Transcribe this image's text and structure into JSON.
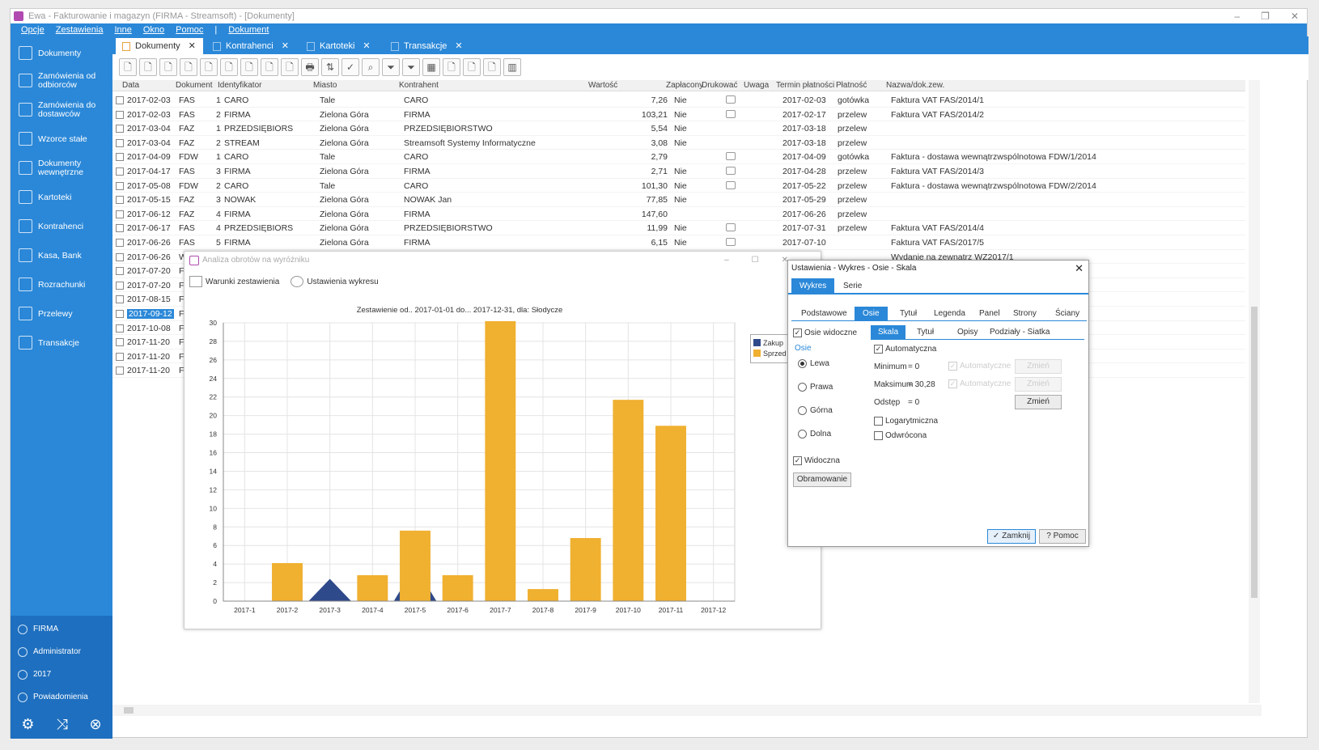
{
  "window": {
    "title": "Ewa - Fakturowanie i magazyn (FIRMA - Streamsoft) - [Dokumenty]",
    "controls": [
      "–",
      "❐",
      "✕"
    ]
  },
  "menu": [
    "Opcje",
    "Zestawienia",
    "Inne",
    "Okno",
    "Pomoc",
    "|",
    "Dokument"
  ],
  "sidebar": {
    "items": [
      {
        "label": "Dokumenty",
        "icon": "documents-icon"
      },
      {
        "label": "Zamówienia od odbiorców",
        "icon": "orders-in-icon"
      },
      {
        "label": "Zamówienia do dostawców",
        "icon": "orders-out-icon"
      },
      {
        "label": "Wzorce stałe",
        "icon": "templates-icon"
      },
      {
        "label": "Dokumenty wewnętrzne",
        "icon": "internal-docs-icon"
      },
      {
        "label": "Kartoteki",
        "icon": "cards-icon"
      },
      {
        "label": "Kontrahenci",
        "icon": "contractors-icon"
      },
      {
        "label": "Kasa, Bank",
        "icon": "cash-bank-icon"
      },
      {
        "label": "Rozrachunki",
        "icon": "settlements-icon"
      },
      {
        "label": "Przelewy",
        "icon": "transfers-icon"
      },
      {
        "label": "Transakcje",
        "icon": "transactions-icon"
      }
    ],
    "bottom": [
      {
        "label": "FIRMA",
        "icon": "home-icon"
      },
      {
        "label": "Administrator",
        "icon": "user-icon"
      },
      {
        "label": "2017",
        "icon": "calendar-icon"
      },
      {
        "label": "Powiadomienia",
        "icon": "bell-icon"
      }
    ],
    "tools": [
      "⚙",
      "⤨",
      "⊗"
    ]
  },
  "tabs": [
    {
      "label": "Dokumenty",
      "close": "✕"
    },
    {
      "label": "Kontrahenci",
      "close": "✕"
    },
    {
      "label": "Kartoteki",
      "close": "✕"
    },
    {
      "label": "Transakcje",
      "close": "✕"
    }
  ],
  "toolbar_icons": [
    "🗋",
    "🗋",
    "🗋",
    "🗋",
    "🗋",
    "🗋",
    "🗋",
    "🗋",
    "🗋",
    "🖶",
    "⇅",
    "✓",
    "⌕",
    "⏷",
    "⏷",
    "▦",
    "🗋",
    "🗋",
    "🗋",
    "▥"
  ],
  "grid": {
    "headers": [
      "Data",
      "Dokument",
      "Identyfikator",
      "Miasto",
      "Kontrahent",
      "Wartość",
      "Zapłacony",
      "Drukować",
      "Uwaga",
      "Termin płatności",
      "Płatność",
      "Nazwa/dok.zew."
    ],
    "rows": [
      {
        "date": "2017-02-03",
        "doc": "FAS",
        "num": "1",
        "id": "CARO",
        "city": "Tale",
        "contractor": "CARO",
        "value": "7,26",
        "paid": "Nie",
        "print": true,
        "due": "2017-02-03",
        "pay": "gotówka",
        "name": "Faktura VAT FAS/2014/1"
      },
      {
        "date": "2017-02-03",
        "doc": "FAS",
        "num": "2",
        "id": "FIRMA",
        "city": "Zielona Góra",
        "contractor": "FIRMA",
        "value": "103,21",
        "paid": "Nie",
        "print": true,
        "due": "2017-02-17",
        "pay": "przelew",
        "name": "Faktura VAT FAS/2014/2"
      },
      {
        "date": "2017-03-04",
        "doc": "FAZ",
        "num": "1",
        "id": "PRZEDSIĘBIORS",
        "city": "Zielona Góra",
        "contractor": "PRZEDSIĘBIORSTWO",
        "value": "5,54",
        "paid": "Nie",
        "print": false,
        "due": "2017-03-18",
        "pay": "przelew",
        "name": ""
      },
      {
        "date": "2017-03-04",
        "doc": "FAZ",
        "num": "2",
        "id": "STREAM",
        "city": "Zielona Góra",
        "contractor": "Streamsoft Systemy Informatyczne",
        "value": "3,08",
        "paid": "Nie",
        "print": false,
        "due": "2017-03-18",
        "pay": "przelew",
        "name": ""
      },
      {
        "date": "2017-04-09",
        "doc": "FDW",
        "num": "1",
        "id": "CARO",
        "city": "Tale",
        "contractor": "CARO",
        "value": "2,79",
        "paid": "",
        "print": true,
        "due": "2017-04-09",
        "pay": "gotówka",
        "name": "Faktura - dostawa wewnątrzwspólnotowa FDW/1/2014"
      },
      {
        "date": "2017-04-17",
        "doc": "FAS",
        "num": "3",
        "id": "FIRMA",
        "city": "Zielona Góra",
        "contractor": "FIRMA",
        "value": "2,71",
        "paid": "Nie",
        "print": true,
        "due": "2017-04-28",
        "pay": "przelew",
        "name": "Faktura VAT FAS/2014/3"
      },
      {
        "date": "2017-05-08",
        "doc": "FDW",
        "num": "2",
        "id": "CARO",
        "city": "Tale",
        "contractor": "CARO",
        "value": "101,30",
        "paid": "Nie",
        "print": true,
        "due": "2017-05-22",
        "pay": "przelew",
        "name": "Faktura - dostawa wewnątrzwspólnotowa FDW/2/2014"
      },
      {
        "date": "2017-05-15",
        "doc": "FAZ",
        "num": "3",
        "id": "NOWAK",
        "city": "Zielona Góra",
        "contractor": "NOWAK Jan",
        "value": "77,85",
        "paid": "Nie",
        "print": false,
        "due": "2017-05-29",
        "pay": "przelew",
        "name": ""
      },
      {
        "date": "2017-06-12",
        "doc": "FAZ",
        "num": "4",
        "id": "FIRMA",
        "city": "Zielona Góra",
        "contractor": "FIRMA",
        "value": "147,60",
        "paid": "",
        "print": false,
        "due": "2017-06-26",
        "pay": "przelew",
        "name": ""
      },
      {
        "date": "2017-06-17",
        "doc": "FAS",
        "num": "4",
        "id": "PRZEDSIĘBIORS",
        "city": "Zielona Góra",
        "contractor": "PRZEDSIĘBIORSTWO",
        "value": "11,99",
        "paid": "Nie",
        "print": true,
        "due": "2017-07-31",
        "pay": "przelew",
        "name": "Faktura VAT FAS/2014/4"
      },
      {
        "date": "2017-06-26",
        "doc": "FAS",
        "num": "5",
        "id": "FIRMA",
        "city": "Zielona Góra",
        "contractor": "FIRMA",
        "value": "6,15",
        "paid": "Nie",
        "print": true,
        "due": "2017-07-10",
        "pay": "",
        "name": "Faktura VAT FAS/2017/5"
      },
      {
        "date": "2017-06-26",
        "doc": "W",
        "num": "",
        "id": "",
        "city": "",
        "contractor": "",
        "value": "",
        "paid": "",
        "print": false,
        "due": "",
        "pay": "",
        "name": "Wydanie na zewnątrz WZ2017/1"
      },
      {
        "date": "2017-07-20",
        "doc": "FA",
        "num": "",
        "id": "",
        "city": "",
        "contractor": "",
        "value": "",
        "paid": "",
        "print": false,
        "due": "",
        "pay": "",
        "name": ""
      },
      {
        "date": "2017-07-20",
        "doc": "FD",
        "num": "",
        "id": "",
        "city": "",
        "contractor": "",
        "value": "",
        "paid": "",
        "print": false,
        "due": "",
        "pay": "",
        "name": ""
      },
      {
        "date": "2017-08-15",
        "doc": "FA",
        "num": "",
        "id": "",
        "city": "",
        "contractor": "",
        "value": "",
        "paid": "",
        "print": false,
        "due": "",
        "pay": "",
        "name": ""
      },
      {
        "date": "2017-09-12",
        "doc": "FA",
        "num": "",
        "id": "",
        "city": "",
        "contractor": "",
        "value": "",
        "paid": "",
        "print": false,
        "due": "",
        "pay": "",
        "name": "",
        "selected": true
      },
      {
        "date": "2017-10-08",
        "doc": "FA",
        "num": "",
        "id": "",
        "city": "",
        "contractor": "",
        "value": "",
        "paid": "",
        "print": false,
        "due": "",
        "pay": "",
        "name": ""
      },
      {
        "date": "2017-11-20",
        "doc": "FA",
        "num": "",
        "id": "",
        "city": "",
        "contractor": "",
        "value": "",
        "paid": "",
        "print": false,
        "due": "",
        "pay": "",
        "name": ""
      },
      {
        "date": "2017-11-20",
        "doc": "FA",
        "num": "",
        "id": "",
        "city": "",
        "contractor": "",
        "value": "",
        "paid": "",
        "print": false,
        "due": "",
        "pay": "",
        "name": ""
      },
      {
        "date": "2017-11-20",
        "doc": "FD",
        "num": "",
        "id": "",
        "city": "",
        "contractor": "",
        "value": "",
        "paid": "",
        "print": false,
        "due": "",
        "pay": "",
        "name": ""
      }
    ]
  },
  "chart_window": {
    "title": "Analiza obrotów na wyróżniku",
    "controls": [
      "–",
      "☐",
      "✕"
    ],
    "tool_conditions": "Warunki zestawienia",
    "tool_settings": "Ustawienia wykresu"
  },
  "chart_data": {
    "type": "bar",
    "title": "Zestawienie od.. 2017-01-01  do... 2017-12-31, dla: Słodycze",
    "categories": [
      "2017-1",
      "2017-2",
      "2017-3",
      "2017-4",
      "2017-5",
      "2017-6",
      "2017-7",
      "2017-8",
      "2017-9",
      "2017-10",
      "2017-11",
      "2017-12"
    ],
    "series": [
      {
        "name": "Zakup",
        "color": "#2f4a8a",
        "type": "area",
        "values": [
          0,
          0,
          2.4,
          0,
          3.8,
          0,
          0,
          0,
          0,
          0,
          0,
          0
        ]
      },
      {
        "name": "Sprzedaż",
        "color": "#f0b030",
        "type": "bar",
        "values": [
          0,
          4.1,
          0,
          2.8,
          7.6,
          2.8,
          30.2,
          1.3,
          6.8,
          21.7,
          18.9,
          0
        ]
      }
    ],
    "yticks": [
      0,
      2,
      4,
      6,
      8,
      10,
      12,
      14,
      16,
      18,
      20,
      22,
      24,
      26,
      28,
      30
    ],
    "ylim": [
      0,
      30.28
    ],
    "grid": true,
    "legend_position": "right",
    "legend_labels": [
      "Zakup",
      "Sprzed"
    ]
  },
  "settings_dialog": {
    "title": "Ustawienia -  Wykres  -  Osie  -  Skala",
    "close": "✕",
    "tabs1": [
      "Wykres",
      "Serie"
    ],
    "tabs2": [
      "Podstawowe",
      "Osie",
      "Tytuł",
      "Legenda",
      "Panel",
      "Strony",
      "Ściany"
    ],
    "tabs3": [
      "Skala",
      "Tytuł",
      "Opisy",
      "Podziały - Siatka"
    ],
    "osie_visible": "Osie widoczne",
    "osie_group": "Osie",
    "axes": [
      "Lewa",
      "Prawa",
      "Górna",
      "Dolna"
    ],
    "axis_selected": "Lewa",
    "automatic": "Automatyczna",
    "min_label": "Minimum",
    "min_value": "= 0",
    "max_label": "Maksimum",
    "max_value": "= 30,28",
    "step_label": "Odstęp",
    "step_value": "= 0",
    "auto_label": "Automatyczne",
    "change_btn": "Zmień",
    "change_btn_disabled": "Zmień",
    "logarithmic": "Logarytmiczna",
    "inverted": "Odwrócona",
    "visible": "Widoczna",
    "border_btn": "Obramowanie",
    "close_btn": "Zamknij",
    "help_btn": "Pomoc"
  }
}
